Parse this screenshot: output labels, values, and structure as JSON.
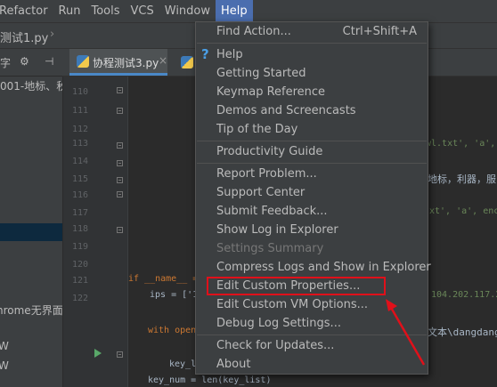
{
  "menubar": {
    "items": [
      "Refactor",
      "Run",
      "Tools",
      "VCS",
      "Window",
      "Help"
    ]
  },
  "navbar": {
    "breadcrumb": "测试1.py"
  },
  "toolrow": {
    "gear": "⚙",
    "collapse": "⊣"
  },
  "tabs": [
    {
      "label": "协程测试3.py",
      "close": "×"
    }
  ],
  "project_panel": {
    "lines": [
      "001-地标、秋",
      "hrome无界面",
      "W",
      "W"
    ]
  },
  "gutter": {
    "line_numbers": [
      "110",
      "111",
      "112",
      "113",
      "114",
      "115",
      "116",
      "117",
      "118",
      "119",
      "120",
      "121",
      "122"
    ]
  },
  "editor": {
    "lines": [
      {
        "text": "wl.txt', 'a',",
        "type": "str"
      },
      {
        "text": "地标，利器，服",
        "type": "plain"
      },
      {
        "text": "xt', 'a', enc",
        "type": "str"
      },
      {
        "text": "if __name__ =",
        "type": "kw"
      },
      {
        "text": "ips = ['1",
        "type": "plain"
      },
      {
        "text": "104.202.117.2",
        "type": "str"
      },
      {
        "text": "with open",
        "type": "kw"
      },
      {
        "text": "文本\\dangdang",
        "type": "plain"
      },
      {
        "text": "key_l",
        "type": "plain"
      },
      {
        "text": "key_num = len(key_list)",
        "type": "plain"
      }
    ]
  },
  "help_menu": {
    "items": [
      {
        "label": "Find Action...",
        "shortcut": "Ctrl+Shift+A"
      },
      {
        "label": "Help"
      },
      {
        "label": "Getting Started"
      },
      {
        "label": "Keymap Reference"
      },
      {
        "label": "Demos and Screencasts"
      },
      {
        "label": "Tip of the Day"
      },
      {
        "label": "Productivity Guide"
      },
      {
        "label": "Report Problem..."
      },
      {
        "label": "Support Center"
      },
      {
        "label": "Submit Feedback..."
      },
      {
        "label": "Show Log in Explorer"
      },
      {
        "label": "Settings Summary",
        "disabled": true
      },
      {
        "label": "Compress Logs and Show in Explorer"
      },
      {
        "label": "Edit Custom Properties...",
        "highlighted": true
      },
      {
        "label": "Edit Custom VM Options..."
      },
      {
        "label": "Debug Log Settings..."
      },
      {
        "label": "Check for Updates..."
      },
      {
        "label": "About"
      }
    ]
  },
  "colors": {
    "menu_bg": "#3c3f41",
    "active_menu": "#4b6eaf",
    "annotation_red": "#e0101a",
    "help_icon": "#4a9fe6"
  }
}
